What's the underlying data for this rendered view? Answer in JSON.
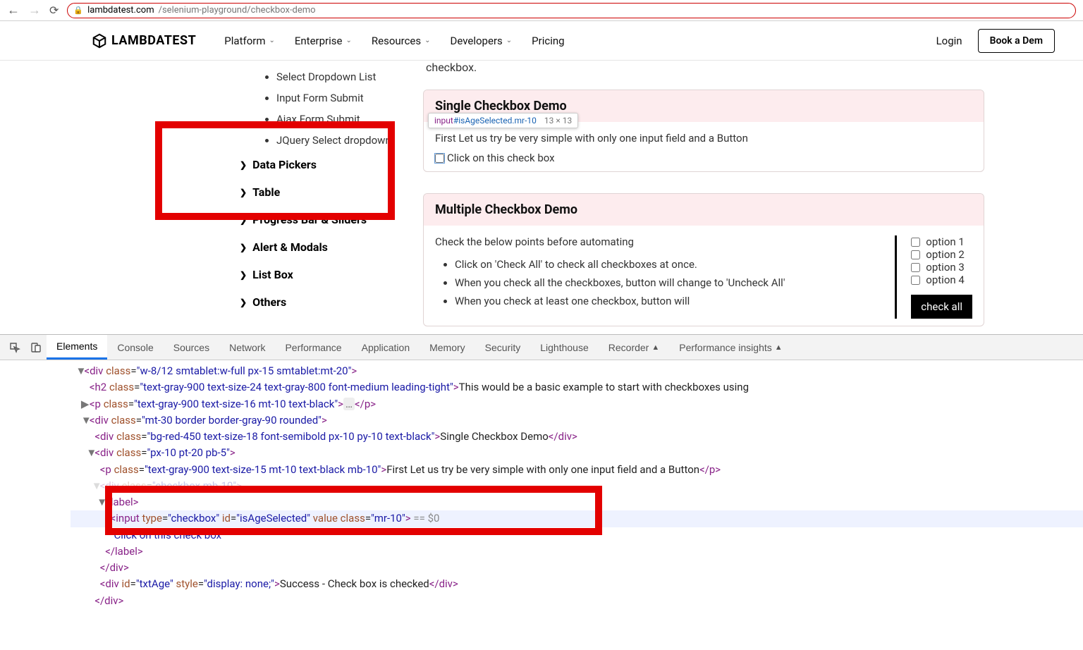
{
  "url": {
    "host": "lambdatest.com",
    "path": "/selenium-playground/checkbox-demo"
  },
  "brand": "LAMBDATEST",
  "nav": {
    "items": [
      {
        "label": "Platform",
        "chev": true
      },
      {
        "label": "Enterprise",
        "chev": true
      },
      {
        "label": "Resources",
        "chev": true
      },
      {
        "label": "Developers",
        "chev": true
      },
      {
        "label": "Pricing",
        "chev": false
      }
    ],
    "login": "Login",
    "book": "Book a Dem"
  },
  "sidebar": {
    "leaves": [
      "Select Dropdown List",
      "Input Form Submit",
      "Ajax Form Submit",
      "JQuery Select dropdown"
    ],
    "sections": [
      "Data Pickers",
      "Table",
      "Progress Bar & Sliders",
      "Alert & Modals",
      "List Box",
      "Others"
    ]
  },
  "intro_fragment": "checkbox.",
  "single": {
    "title": "Single Checkbox Demo",
    "lead": "First Let us try be very simple with only one input field and a Button",
    "label": "Click on this check box"
  },
  "multi": {
    "title": "Multiple Checkbox Demo",
    "lead": "Check the below points before automating",
    "bullets": [
      "Click on 'Check All' to check all checkboxes at once.",
      "When you check all the checkboxes, button will change to 'Uncheck All'",
      "When you check at least one checkbox, button will"
    ],
    "options": [
      "option 1",
      "option 2",
      "option 3",
      "option 4"
    ],
    "button": "check all"
  },
  "inspector_tip": {
    "selector_tag": "input",
    "selector_idcls": "#isAgeSelected.mr-10",
    "dims": "13 × 13"
  },
  "devtools": {
    "tabs": [
      "Elements",
      "Console",
      "Sources",
      "Network",
      "Performance",
      "Application",
      "Memory",
      "Security",
      "Lighthouse",
      "Recorder",
      "Performance insights"
    ],
    "active_tab": 0,
    "code_lines": [
      {
        "indent": 1,
        "carat": "▼",
        "html": "<span class=tag>&lt;div</span> <span class=attr>class</span>=<span class=val>\"w-8/12 smtablet:w-full px-15 smtablet:mt-20\"</span><span class=tag>&gt;</span>"
      },
      {
        "indent": 2,
        "carat": "",
        "html": "<span class=tag>&lt;h2</span> <span class=attr>class</span>=<span class=val>\"text-gray-900 text-size-24 text-gray-800 font-medium leading-tight\"</span><span class=tag>&gt;</span>This would be a basic example to start with checkboxes using"
      },
      {
        "indent": 2,
        "carat": "▶",
        "html": "<span class=tag>&lt;p</span> <span class=attr>class</span>=<span class=val>\"text-gray-900 text-size-16 mt-10 text-black\"</span><span class=tag>&gt;</span><span class=ellip>…</span><span class=tag>&lt;/p&gt;</span>"
      },
      {
        "indent": 2,
        "carat": "▼",
        "html": "<span class=tag>&lt;div</span> <span class=attr>class</span>=<span class=val>\"mt-30 border border-gray-90 rounded\"</span><span class=tag>&gt;</span>"
      },
      {
        "indent": 3,
        "carat": "",
        "html": "<span class=tag>&lt;div</span> <span class=attr>class</span>=<span class=val>\"bg-red-450 text-size-18 font-semibold px-10 py-10 text-black\"</span><span class=tag>&gt;</span>Single Checkbox Demo<span class=tag>&lt;/div&gt;</span>"
      },
      {
        "indent": 3,
        "carat": "▼",
        "html": "<span class=tag>&lt;div</span> <span class=attr>class</span>=<span class=val>\"px-10 pt-20 pb-5\"</span><span class=tag>&gt;</span>"
      },
      {
        "indent": 4,
        "carat": "",
        "html": "<span class=tag>&lt;p</span> <span class=attr>class</span>=<span class=val>\"text-gray-900 text-size-15 mt-10 text-black mb-10\"</span><span class=tag>&gt;</span>First Let us try be very simple with only one input field and a Button<span class=tag>&lt;/p&gt;</span>"
      },
      {
        "indent": 4,
        "carat": "▼",
        "html": "<span class=tag>&lt;div</span> <span class=attr>class</span>=<span class=val>\"checkbox mb-10\"</span><span class=tag>&gt;</span>",
        "obscured": true
      },
      {
        "indent": 5,
        "carat": "▼",
        "html": "<span class=tag>&lt;label&gt;</span>"
      },
      {
        "indent": 6,
        "carat": "",
        "html": "<span class=tag>&lt;input</span> <span class=attr>type</span>=<span class=val>\"checkbox\"</span> <span class=attr>id</span>=<span class=val>\"isAgeSelected\"</span> <span class=attr>value</span> <span class=attr>class</span>=<span class=val>\"mr-10\"</span><span class=tag>&gt;</span> <span class=pseudo>== </span><span class=pseudo>$0</span>",
        "hl": true
      },
      {
        "indent": 6,
        "carat": "",
        "html": "<span class=val>\"Click on this check box\"</span>"
      },
      {
        "indent": 5,
        "carat": "",
        "html": "<span class=tag>&lt;/label&gt;</span>"
      },
      {
        "indent": 4,
        "carat": "",
        "html": "<span class=tag>&lt;/div&gt;</span>"
      },
      {
        "indent": 4,
        "carat": "",
        "html": "<span class=tag>&lt;div</span> <span class=attr>id</span>=<span class=val>\"txtAge\"</span> <span class=attr>style</span>=<span class=val>\"display: none;\"</span><span class=tag>&gt;</span>Success - Check box is checked<span class=tag>&lt;/div&gt;</span>"
      },
      {
        "indent": 3,
        "carat": "",
        "html": "<span class=tag>&lt;/div&gt;</span>"
      }
    ]
  }
}
